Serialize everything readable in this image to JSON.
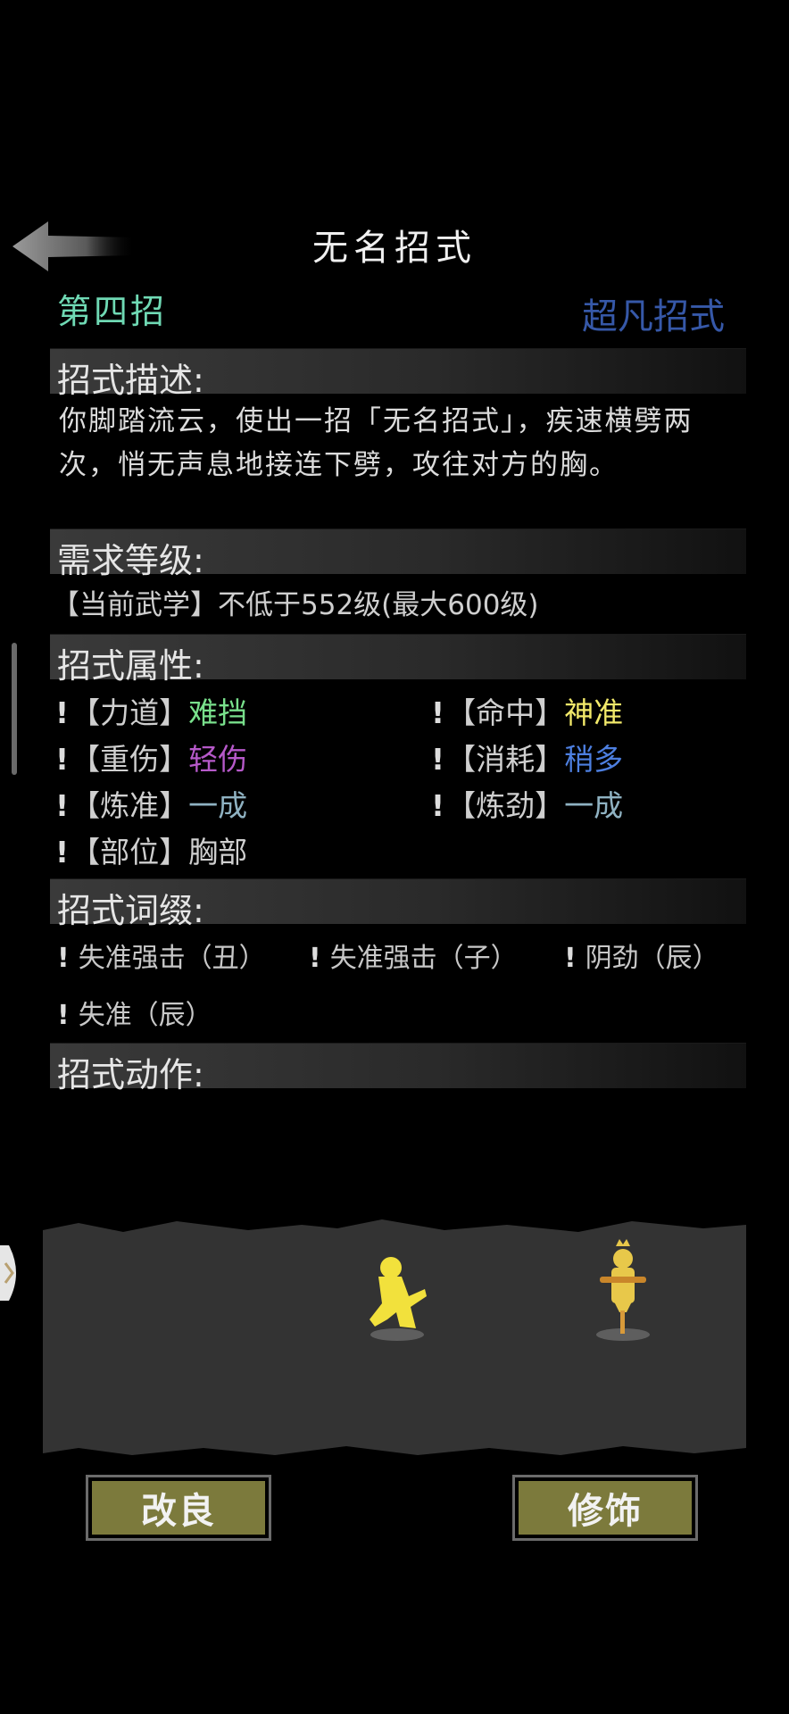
{
  "header": {
    "title": "无名招式",
    "back_icon": "back-arrow-icon"
  },
  "move": {
    "number": "第四招",
    "rank": "超凡招式"
  },
  "sections": {
    "description": "招式描述:",
    "requirement": "需求等级:",
    "attributes": "招式属性:",
    "affixes": "招式词缀:",
    "animation": "招式动作:"
  },
  "description_text": "你脚踏流云，使出一招「无名招式」，疾速横劈两次，悄无声息地接连下劈，攻往对方的胸。",
  "requirement_text": "【当前武学】不低于552级(最大600级)",
  "attributes": [
    {
      "mark": "!",
      "key": "【力道】",
      "value": "难挡",
      "color": "#79e08c"
    },
    {
      "mark": "!",
      "key": "【命中】",
      "value": "神准",
      "color": "#f2e96a"
    },
    {
      "mark": "!",
      "key": "【重伤】",
      "value": "轻伤",
      "color": "#b659c9"
    },
    {
      "mark": "!",
      "key": "【消耗】",
      "value": "稍多",
      "color": "#4d7fe0"
    },
    {
      "mark": "!",
      "key": "【炼准】",
      "value": "一成",
      "color": "#8fb2c2"
    },
    {
      "mark": "!",
      "key": "【炼劲】",
      "value": "一成",
      "color": "#8fb2c2"
    },
    {
      "mark": "!",
      "key": "【部位】",
      "value": "胸部",
      "color": "#cfcfcf"
    }
  ],
  "affixes": [
    {
      "mark": "!",
      "label": "失准强击（丑）"
    },
    {
      "mark": "!",
      "label": "失准强击（子）"
    },
    {
      "mark": "!",
      "label": "阴劲（辰）"
    },
    {
      "mark": "!",
      "label": "失准（辰）"
    }
  ],
  "buttons": {
    "improve": "改良",
    "decorate": "修饰"
  },
  "colors": {
    "move_number": "#6fd9b4",
    "move_rank": "#3658a8",
    "button_bg": "#7c7a3c",
    "fighter": "#f2e13c",
    "dummy": "#e8c84a"
  }
}
